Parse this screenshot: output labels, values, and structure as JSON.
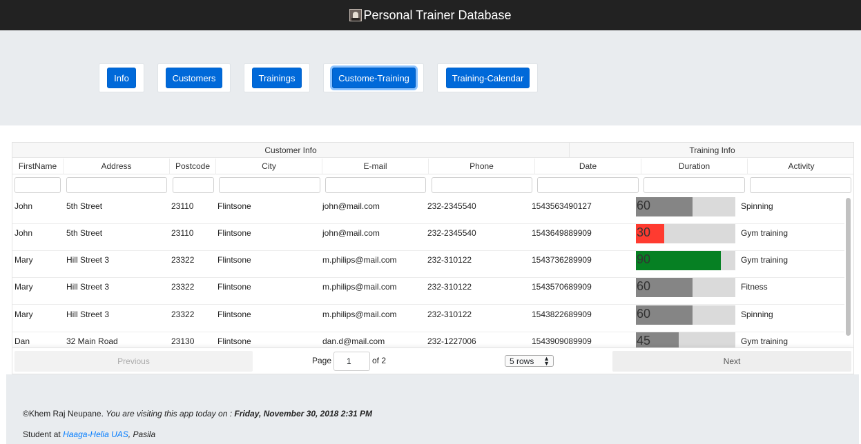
{
  "header": {
    "title": "Personal Trainer Database",
    "logo_icon": "trainer-logo-icon"
  },
  "nav": {
    "buttons": [
      {
        "label": "Info"
      },
      {
        "label": "Customers"
      },
      {
        "label": "Trainings"
      },
      {
        "label": "Custome-Training",
        "active": true
      },
      {
        "label": "Training-Calendar"
      }
    ]
  },
  "table": {
    "groups": [
      "Customer Info",
      "Training Info"
    ],
    "columns": [
      "FirstName",
      "Address",
      "Postcode",
      "City",
      "E-mail",
      "Phone",
      "Date",
      "Duration",
      "Activity"
    ],
    "rows": [
      {
        "firstname": "John",
        "address": "5th Street",
        "postcode": "23110",
        "city": "Flintsone",
        "email": "john@mail.com",
        "phone": "232-2345540",
        "date": "1543563490127",
        "duration": "60",
        "activity": "Spinning"
      },
      {
        "firstname": "John",
        "address": "5th Street",
        "postcode": "23110",
        "city": "Flintsone",
        "email": "john@mail.com",
        "phone": "232-2345540",
        "date": "1543649889909",
        "duration": "30",
        "activity": "Gym training"
      },
      {
        "firstname": "Mary",
        "address": "Hill Street 3",
        "postcode": "23322",
        "city": "Flintsone",
        "email": "m.philips@mail.com",
        "phone": "232-310122",
        "date": "1543736289909",
        "duration": "90",
        "activity": "Gym training"
      },
      {
        "firstname": "Mary",
        "address": "Hill Street 3",
        "postcode": "23322",
        "city": "Flintsone",
        "email": "m.philips@mail.com",
        "phone": "232-310122",
        "date": "1543570689909",
        "duration": "60",
        "activity": "Fitness"
      },
      {
        "firstname": "Mary",
        "address": "Hill Street 3",
        "postcode": "23322",
        "city": "Flintsone",
        "email": "m.philips@mail.com",
        "phone": "232-310122",
        "date": "1543822689909",
        "duration": "60",
        "activity": "Spinning"
      },
      {
        "firstname": "Dan",
        "address": "32 Main Road",
        "postcode": "23130",
        "city": "Flintsone",
        "email": "dan.d@mail.com",
        "phone": "232-1227006",
        "date": "1543909089909",
        "duration": "45",
        "activity": "Gym training"
      }
    ],
    "duration_max": 105,
    "colors": {
      "low": "#ff3b30",
      "normal": "#858585",
      "high": "#068023",
      "track": "#dadada"
    }
  },
  "pagination": {
    "previous": "Previous",
    "page_label": "Page",
    "page_value": "1",
    "of_label": "of 2",
    "rows_select": "5 rows",
    "next": "Next"
  },
  "footer": {
    "copyright": "©Khem Raj Neupane.",
    "visiting": "You are visiting this app today on :",
    "datetime": "Friday, November 30, 2018 2:31 PM",
    "student_at": "Student at",
    "school_link": "Haaga-Helia UAS",
    "campus": ", Pasila"
  }
}
